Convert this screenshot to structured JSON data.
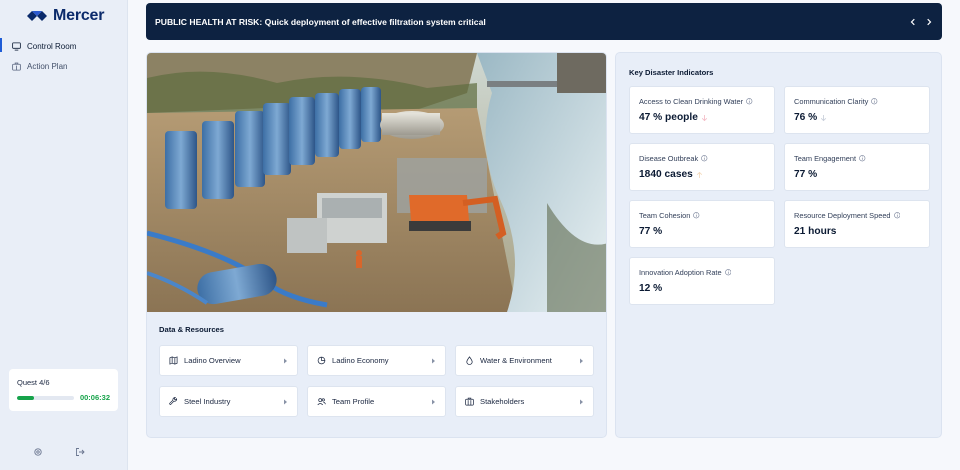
{
  "app": {
    "logo_text": "Mercer"
  },
  "sidebar": {
    "items": [
      {
        "label": "Control Room",
        "icon": "monitor-icon",
        "active": true
      },
      {
        "label": "Action Plan",
        "icon": "briefcase-icon",
        "active": false
      }
    ],
    "quest": {
      "label": "Quest 4/6",
      "timer": "00:06:32",
      "progress": 0.3
    }
  },
  "banner": {
    "text": "PUBLIC HEALTH AT RISK: Quick deployment of effective filtration system critical"
  },
  "resources": {
    "title": "Data & Resources",
    "items": [
      {
        "label": "Ladino Overview",
        "icon": "map-icon"
      },
      {
        "label": "Ladino Economy",
        "icon": "pie-chart-icon"
      },
      {
        "label": "Water & Environment",
        "icon": "droplet-icon"
      },
      {
        "label": "Steel Industry",
        "icon": "wrench-icon"
      },
      {
        "label": "Team Profile",
        "icon": "users-icon"
      },
      {
        "label": "Stakeholders",
        "icon": "briefcase-icon"
      }
    ]
  },
  "indicators": {
    "title": "Key Disaster Indicators",
    "items": [
      {
        "label": "Access to Clean Drinking Water",
        "value": "47 % people",
        "trend": "down"
      },
      {
        "label": "Communication Clarity",
        "value": "76 %",
        "trend": "down"
      },
      {
        "label": "Disease Outbreak",
        "value": "1840 cases",
        "trend": "up"
      },
      {
        "label": "Team Engagement",
        "value": "77 %",
        "trend": ""
      },
      {
        "label": "Team Cohesion",
        "value": "77 %",
        "trend": ""
      },
      {
        "label": "Resource Deployment Speed",
        "value": "21 hours",
        "trend": ""
      },
      {
        "label": "Innovation Adoption Rate",
        "value": "12 %",
        "trend": ""
      }
    ]
  },
  "colors": {
    "accent": "#1f5cd6",
    "banner_bg": "#0d2241",
    "progress": "#16a34a"
  }
}
